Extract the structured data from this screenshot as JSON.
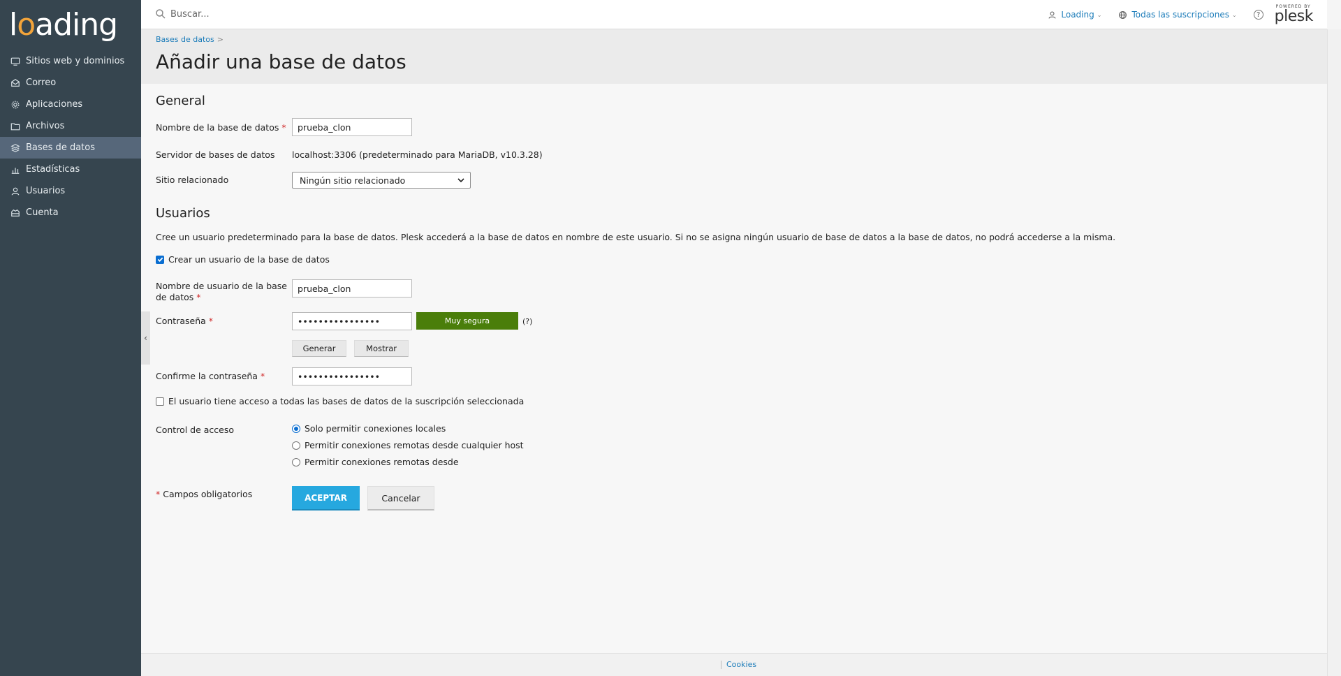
{
  "brand": {
    "logo_pre": "l",
    "logo_o": "o",
    "logo_post": "ading"
  },
  "sidebar": {
    "items": [
      {
        "label": "Sitios web y dominios",
        "icon": "monitor-icon"
      },
      {
        "label": "Correo",
        "icon": "mail-icon"
      },
      {
        "label": "Aplicaciones",
        "icon": "gear-icon"
      },
      {
        "label": "Archivos",
        "icon": "folder-icon"
      },
      {
        "label": "Bases de datos",
        "icon": "database-icon",
        "active": true
      },
      {
        "label": "Estadísticas",
        "icon": "bar-chart-icon"
      },
      {
        "label": "Usuarios",
        "icon": "user-icon"
      },
      {
        "label": "Cuenta",
        "icon": "account-icon"
      }
    ]
  },
  "topbar": {
    "search_placeholder": "Buscar...",
    "user_label": "Loading",
    "subscriptions_label": "Todas las suscripciones",
    "help_label": "?",
    "powered_by": "POWERED BY",
    "plesk": "plesk"
  },
  "header": {
    "breadcrumb": "Bases de datos",
    "breadcrumb_sep": ">",
    "title": "Añadir una base de datos"
  },
  "general": {
    "title": "General",
    "db_name_label": "Nombre de la base de datos",
    "db_name_value": "prueba_clon",
    "server_label": "Servidor de bases de datos",
    "server_value": "localhost:3306 (predeterminado para MariaDB, v10.3.28)",
    "site_label": "Sitio relacionado",
    "site_value": "Ningún sitio relacionado"
  },
  "users": {
    "title": "Usuarios",
    "description": "Cree un usuario predeterminado para la base de datos. Plesk accederá a la base de datos en nombre de este usuario. Si no se asigna ningún usuario de base de datos a la base de datos, no podrá accederse a la misma.",
    "create_user_label": "Crear un usuario de la base de datos",
    "create_user_checked": true,
    "username_label_1": "Nombre de usuario de la base",
    "username_label_2": "de datos",
    "username_value": "prueba_clon",
    "password_label": "Contraseña",
    "password_value": "••••••••••••••••",
    "strength_label": "Muy segura",
    "strength_help": "(?)",
    "generate_label": "Generar",
    "show_label": "Mostrar",
    "confirm_label": "Confirme la contraseña",
    "confirm_value": "••••••••••••••••",
    "all_dbs_label": "El usuario tiene acceso a todas las bases de datos de la suscripción seleccionada",
    "all_dbs_checked": false,
    "access_label": "Control de acceso",
    "access_options": [
      {
        "label": "Solo permitir conexiones locales",
        "selected": true
      },
      {
        "label": "Permitir conexiones remotas desde cualquier host",
        "selected": false
      },
      {
        "label": "Permitir conexiones remotas desde",
        "selected": false
      }
    ]
  },
  "form": {
    "required_star": "*",
    "required_note": "Campos obligatorios",
    "ok_label": "ACEPTAR",
    "cancel_label": "Cancelar"
  },
  "footer": {
    "cookies": "Cookies"
  },
  "colors": {
    "sidebar_bg": "#36454f",
    "active_item": "#56677a",
    "link": "#1a7bb9",
    "primary_button": "#26a8df",
    "strength_bar": "#4a7e0a",
    "required": "#d02b2b"
  }
}
